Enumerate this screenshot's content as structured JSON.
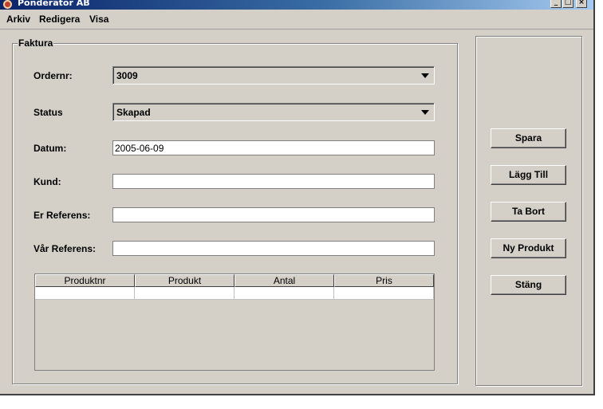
{
  "window": {
    "title": "Ponderator AB"
  },
  "menu": [
    "Arkiv",
    "Redigera",
    "Visa"
  ],
  "form": {
    "group_title": "Faktura",
    "ordernr": {
      "label": "Ordernr:",
      "value": "3009"
    },
    "status": {
      "label": "Status",
      "value": "Skapad"
    },
    "datum": {
      "label": "Datum:",
      "value": "2005-06-09"
    },
    "kund": {
      "label": "Kund:",
      "value": ""
    },
    "er_referens": {
      "label": "Er Referens:",
      "value": ""
    },
    "var_referens": {
      "label": "Vår Referens:",
      "value": ""
    }
  },
  "table": {
    "columns": [
      "Produktnr",
      "Produkt",
      "Antal",
      "Pris"
    ],
    "rows": [
      [
        "",
        "",
        "",
        ""
      ]
    ]
  },
  "buttons": {
    "spara": "Spara",
    "lagg_till": "Lägg Till",
    "ta_bort": "Ta Bort",
    "ny_produkt": "Ny Produkt",
    "stang": "Stäng"
  }
}
